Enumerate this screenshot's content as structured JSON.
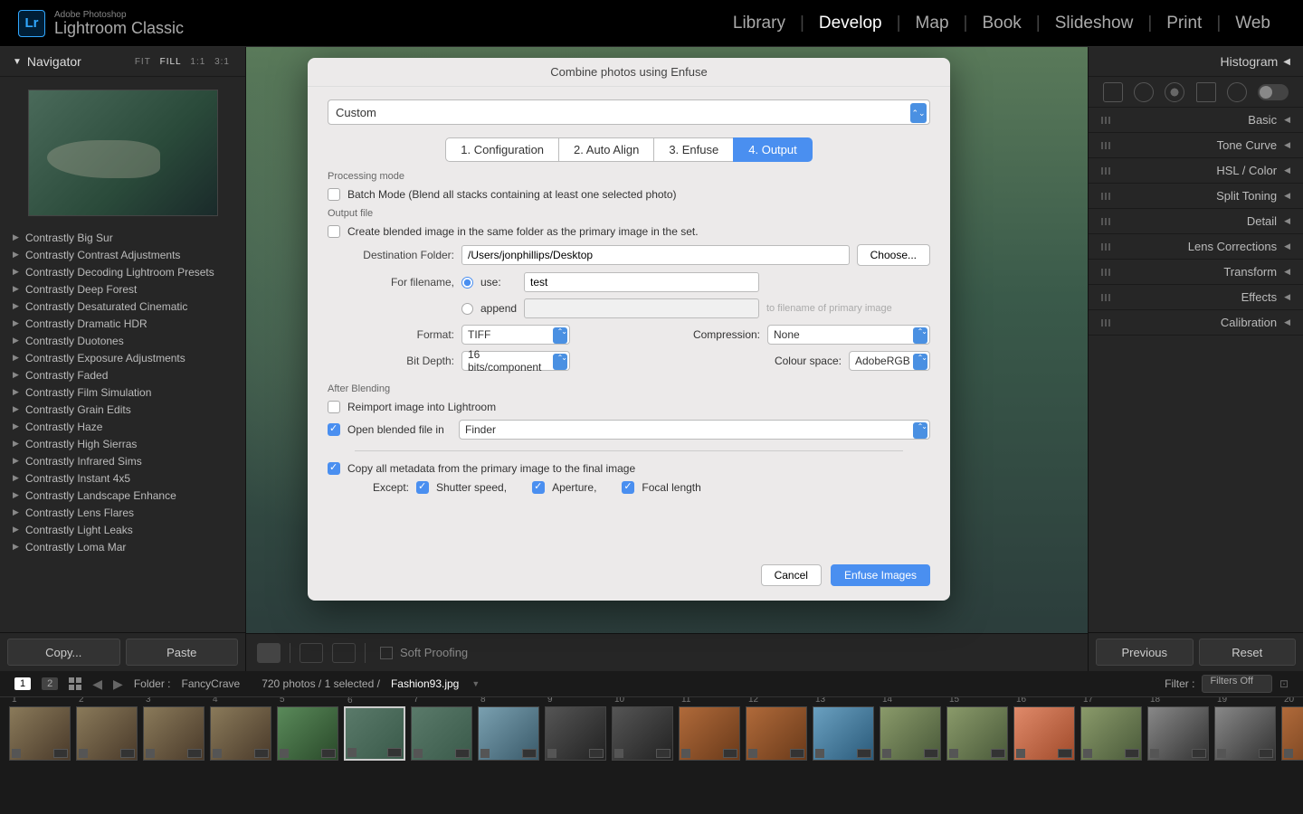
{
  "app": {
    "badge": "Lr",
    "brand1": "Adobe Photoshop",
    "brand2": "Lightroom Classic"
  },
  "modules": [
    "Library",
    "Develop",
    "Map",
    "Book",
    "Slideshow",
    "Print",
    "Web"
  ],
  "active_module": "Develop",
  "navigator": {
    "title": "Navigator",
    "zoom": {
      "fit": "FIT",
      "fill": "FILL",
      "one": "1:1",
      "three": "3:1"
    }
  },
  "presets": [
    "Contrastly Big Sur",
    "Contrastly Contrast Adjustments",
    "Contrastly Decoding Lightroom Presets",
    "Contrastly Deep Forest",
    "Contrastly Desaturated Cinematic",
    "Contrastly Dramatic HDR",
    "Contrastly Duotones",
    "Contrastly Exposure Adjustments",
    "Contrastly Faded",
    "Contrastly Film Simulation",
    "Contrastly Grain Edits",
    "Contrastly Haze",
    "Contrastly High Sierras",
    "Contrastly Infrared Sims",
    "Contrastly Instant 4x5",
    "Contrastly Landscape Enhance",
    "Contrastly Lens Flares",
    "Contrastly Light Leaks",
    "Contrastly Loma Mar"
  ],
  "left_buttons": {
    "copy": "Copy...",
    "paste": "Paste"
  },
  "histogram_label": "Histogram",
  "right_sections": [
    "Basic",
    "Tone Curve",
    "HSL / Color",
    "Split Toning",
    "Detail",
    "Lens Corrections",
    "Transform",
    "Effects",
    "Calibration"
  ],
  "right_buttons": {
    "prev": "Previous",
    "reset": "Reset"
  },
  "soft_proof": "Soft Proofing",
  "status": {
    "page1": "1",
    "page2": "2",
    "folder_label": "Folder :",
    "folder": "FancyCrave",
    "count": "720 photos / 1 selected /",
    "file": "Fashion93.jpg",
    "filter_label": "Filter :",
    "filter_value": "Filters Off"
  },
  "dialog": {
    "title": "Combine photos using Enfuse",
    "preset": "Custom",
    "tabs": [
      "1. Configuration",
      "2. Auto Align",
      "3. Enfuse",
      "4. Output"
    ],
    "active_tab": 3,
    "sections": {
      "processing": "Processing mode",
      "output": "Output file",
      "after": "After Blending"
    },
    "batch_label": "Batch Mode (Blend all stacks containing at least one selected photo)",
    "same_folder_label": "Create blended image in the same folder as the primary image in the set.",
    "dest_label": "Destination Folder:",
    "dest_value": "/Users/jonphillips/Desktop",
    "choose": "Choose...",
    "filename_label": "For filename,",
    "use_label": "use:",
    "use_value": "test",
    "append_label": "append",
    "append_hint": "to filename of primary image",
    "format_label": "Format:",
    "format_value": "TIFF",
    "compression_label": "Compression:",
    "compression_value": "None",
    "bitdepth_label": "Bit Depth:",
    "bitdepth_value": "16 bits/component",
    "colorspace_label": "Colour space:",
    "colorspace_value": "AdobeRGB",
    "reimport_label": "Reimport image into Lightroom",
    "openin_label": "Open blended file in",
    "openin_value": "Finder",
    "copymeta_label": "Copy all metadata from the primary image to the final image",
    "except_label": "Except:",
    "shutter": "Shutter speed,",
    "aperture": "Aperture,",
    "focal": "Focal length",
    "cancel": "Cancel",
    "enfuse": "Enfuse Images"
  },
  "thumbs": [
    1,
    2,
    3,
    4,
    5,
    6,
    7,
    8,
    9,
    10,
    11,
    12,
    13,
    14,
    15,
    16,
    17,
    18,
    19,
    20
  ]
}
